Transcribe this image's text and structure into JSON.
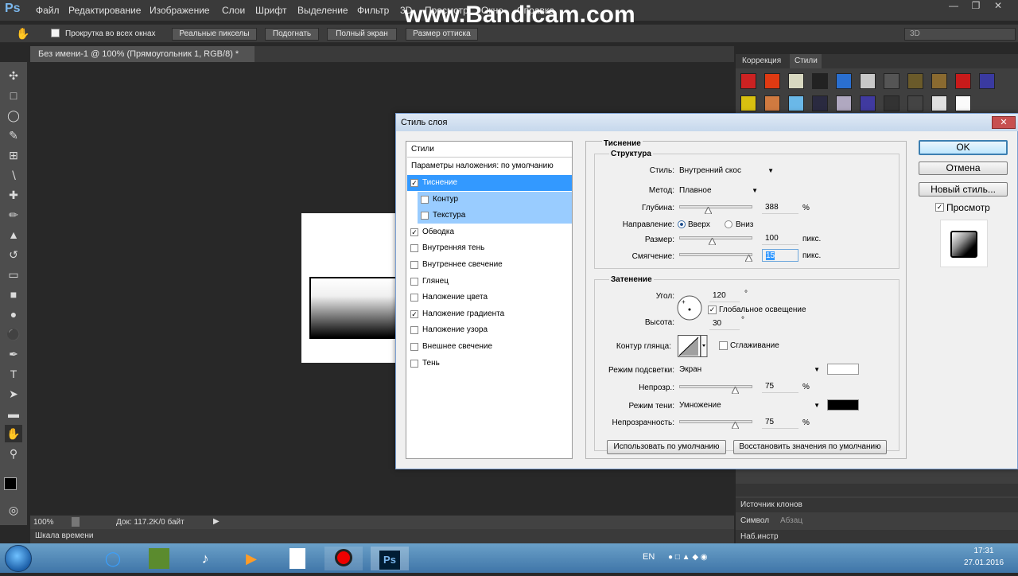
{
  "app": {
    "logo": "Ps",
    "menu": [
      "Файл",
      "Редактирование",
      "Изображение",
      "Слои",
      "Шрифт",
      "Выделение",
      "Фильтр",
      "3D",
      "Просмотр",
      "Окно",
      "Справка"
    ],
    "watermark": "www.Bandicam.com",
    "workspace": "3D"
  },
  "options_bar": {
    "scroll_all": "Прокрутка во всех окнах",
    "buttons": [
      "Реальные пикселы",
      "Подогнать",
      "Полный экран",
      "Размер оттиска"
    ]
  },
  "document": {
    "tab_title": "Без имени-1 @ 100% (Прямоугольник 1, RGB/8) *",
    "zoom": "100%",
    "doc_info": "Док: 117.2K/0 байт",
    "timeline": "Шкала времени"
  },
  "right_panel": {
    "tabs": [
      "Коррекция",
      "Стили"
    ],
    "bottom_panels": [
      "Источник клонов",
      "Символ",
      "Абзац",
      "Наб.инстр"
    ]
  },
  "dialog": {
    "title": "Стиль слоя",
    "list_header": "Стили",
    "blend_defaults": "Параметры наложения: по умолчанию",
    "items": [
      {
        "label": "Тиснение",
        "checked": true
      },
      {
        "label": "Контур",
        "checked": false
      },
      {
        "label": "Текстура",
        "checked": false
      },
      {
        "label": "Обводка",
        "checked": true
      },
      {
        "label": "Внутренняя тень",
        "checked": false
      },
      {
        "label": "Внутреннее свечение",
        "checked": false
      },
      {
        "label": "Глянец",
        "checked": false
      },
      {
        "label": "Наложение цвета",
        "checked": false
      },
      {
        "label": "Наложение градиента",
        "checked": true
      },
      {
        "label": "Наложение узора",
        "checked": false
      },
      {
        "label": "Внешнее свечение",
        "checked": false
      },
      {
        "label": "Тень",
        "checked": false
      }
    ],
    "section_title": "Тиснение",
    "structure": {
      "title": "Структура",
      "style_label": "Стиль:",
      "style_value": "Внутренний скос",
      "method_label": "Метод:",
      "method_value": "Плавное",
      "depth_label": "Глубина:",
      "depth_value": "388",
      "depth_unit": "%",
      "direction_label": "Направление:",
      "dir_up": "Вверх",
      "dir_down": "Вниз",
      "size_label": "Размер:",
      "size_value": "100",
      "size_unit": "пикс.",
      "soften_label": "Смягчение:",
      "soften_value": "15",
      "soften_unit": "пикс."
    },
    "shading": {
      "title": "Затенение",
      "angle_label": "Угол:",
      "angle_value": "120",
      "angle_unit": "°",
      "global_light": "Глобальное освещение",
      "altitude_label": "Высота:",
      "altitude_value": "30",
      "altitude_unit": "°",
      "gloss_label": "Контур глянца:",
      "antialias": "Сглаживание",
      "highlight_label": "Режим подсветки:",
      "highlight_value": "Экран",
      "highlight_opacity_label": "Непрозр.:",
      "highlight_opacity": "75",
      "pct": "%",
      "shadow_label": "Режим тени:",
      "shadow_value": "Умножение",
      "shadow_opacity_label": "Непрозрачность:",
      "shadow_opacity": "75"
    },
    "make_default": "Использовать по умолчанию",
    "reset_default": "Восстановить значения по умолчанию",
    "ok": "OK",
    "cancel": "Отмена",
    "new_style": "Новый стиль...",
    "preview": "Просмотр"
  },
  "taskbar": {
    "lang": "EN",
    "time": "17:31",
    "date": "27.01.2016"
  }
}
